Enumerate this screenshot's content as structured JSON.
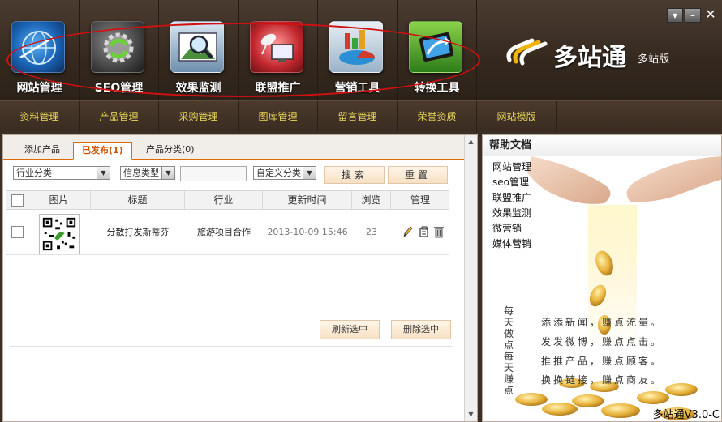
{
  "toolbar": {
    "items": [
      {
        "label": "网站管理",
        "icon": "globe-gear-icon"
      },
      {
        "label": "SEO管理",
        "icon": "refresh-gear-icon"
      },
      {
        "label": "效果监测",
        "icon": "magnifier-icon"
      },
      {
        "label": "联盟推广",
        "icon": "satellite-monitor-icon"
      },
      {
        "label": "营销工具",
        "icon": "pie-chart-icon"
      },
      {
        "label": "转换工具",
        "icon": "tablet-arrow-icon"
      }
    ]
  },
  "brand": {
    "name": "多站通",
    "edition": "多站版"
  },
  "window_controls": {
    "menu": "▾",
    "minimize": "–",
    "close": "✕"
  },
  "submenu": [
    "资料管理",
    "产品管理",
    "采购管理",
    "图库管理",
    "留言管理",
    "荣誉资质",
    "网站模版"
  ],
  "tabs": [
    {
      "label": "添加产品",
      "active": false
    },
    {
      "label": "已发布(1)",
      "active": true
    },
    {
      "label": "产品分类(0)",
      "active": false
    }
  ],
  "filters": {
    "industry": "行业分类",
    "info_type": "信息类型",
    "custom": "自定义分类",
    "search_button": "搜索",
    "reset_button": "重置"
  },
  "table": {
    "headers": [
      "图片",
      "标题",
      "行业",
      "更新时间",
      "浏览",
      "管理"
    ],
    "rows": [
      {
        "title": "分散打发斯蒂芬",
        "industry": "旅游项目合作",
        "updated": "2013-10-09 15:46",
        "views": "23"
      }
    ]
  },
  "actions": {
    "refresh_selected": "刷新选中",
    "delete_selected": "删除选中"
  },
  "help": {
    "title": "帮助文档",
    "links": [
      "网站管理",
      "seo管理",
      "联盟推广",
      "效果监测",
      "微营销",
      "媒体营销"
    ],
    "vertical_text": "每天做点每天赚点",
    "slogans": [
      "添添新闻，赚点流量。",
      "发发微博，赚点点击。",
      "推推产品，赚点顾客。",
      "换换链接，赚点商友。"
    ],
    "version": "多站通V3.0-C"
  },
  "colors": {
    "accent": "#e06a00",
    "submenu_text": "#e9d55b",
    "toolbar_bg": "#3b2f26",
    "highlight_oval": "#d01010"
  }
}
